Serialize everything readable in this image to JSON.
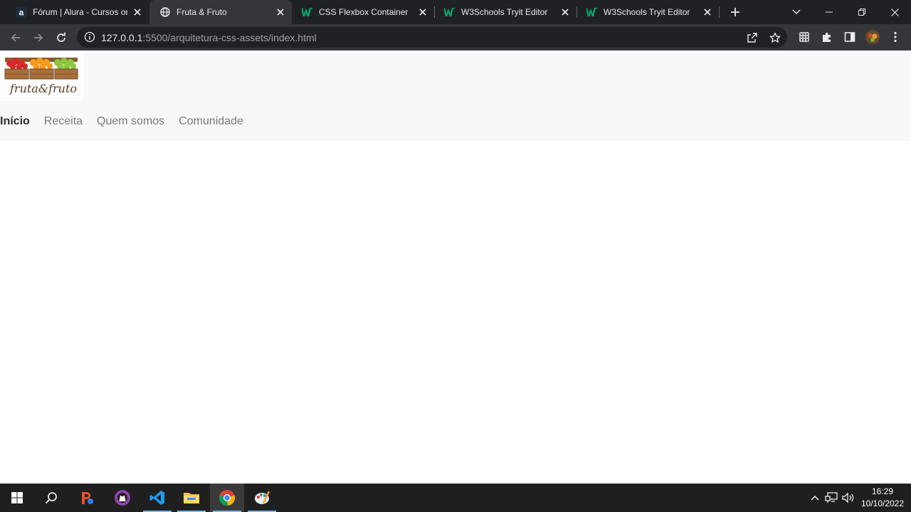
{
  "browser": {
    "tabs": [
      {
        "title": "Fórum | Alura - Cursos online de tecnologia",
        "favicon": "alura-icon",
        "active": false
      },
      {
        "title": "Fruta & Fruto",
        "favicon": "globe-icon",
        "active": true
      },
      {
        "title": "CSS Flexbox Container",
        "favicon": "w3schools-icon",
        "active": false
      },
      {
        "title": "W3Schools Tryit Editor",
        "favicon": "w3schools-icon",
        "active": false
      },
      {
        "title": "W3Schools Tryit Editor",
        "favicon": "w3schools-icon",
        "active": false
      }
    ],
    "url": {
      "host": "127.0.0.1",
      "rest": ":5500/arquitetura-css-assets/index.html"
    }
  },
  "site": {
    "logo_text": "fruta&fruto",
    "nav": [
      {
        "label": "Início",
        "active": true
      },
      {
        "label": "Receita",
        "active": false
      },
      {
        "label": "Quem somos",
        "active": false
      },
      {
        "label": "Comunidade",
        "active": false
      }
    ]
  },
  "taskbar": {
    "apps": [
      "windows-start-icon",
      "search-icon",
      "postman-icon",
      "github-desktop-icon",
      "vscode-icon",
      "file-explorer-icon",
      "chrome-icon",
      "paint-icon"
    ],
    "time": "16:29",
    "date": "10/10/2022"
  },
  "colors": {
    "tabstrip": "#202124",
    "toolbar": "#35363a",
    "header_bg": "#f8f8f8",
    "nav_inactive": "#7a7a7a",
    "nav_active": "#2b2b2b",
    "taskbar": "#1f1f1f"
  }
}
